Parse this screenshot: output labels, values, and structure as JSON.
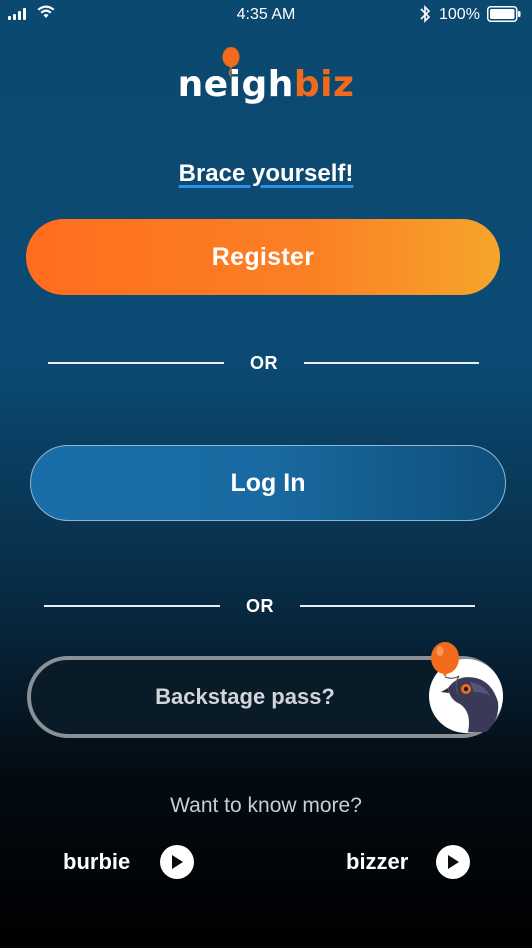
{
  "status_bar": {
    "time": "4:35 AM",
    "battery": "100%"
  },
  "logo": {
    "part1": "neigh",
    "part2": "biz"
  },
  "tagline": "Brace yourself!",
  "buttons": {
    "register": "Register",
    "login": "Log In",
    "backstage": "Backstage pass?"
  },
  "dividers": {
    "first": "OR",
    "second": "OR"
  },
  "footer": {
    "prompt": "Want to know more?",
    "links": [
      {
        "label": "burbie"
      },
      {
        "label": "bizzer"
      }
    ]
  },
  "colors": {
    "accent_orange": "#ff6d1f",
    "accent_blue": "#1a6ea8",
    "background_top": "#0c4970",
    "underline_blue": "#2f8ee5"
  },
  "icons": [
    "signal-icon",
    "wifi-icon",
    "bluetooth-icon",
    "battery-icon",
    "balloon-icon",
    "pigeon-mascot-icon",
    "play-icon"
  ]
}
